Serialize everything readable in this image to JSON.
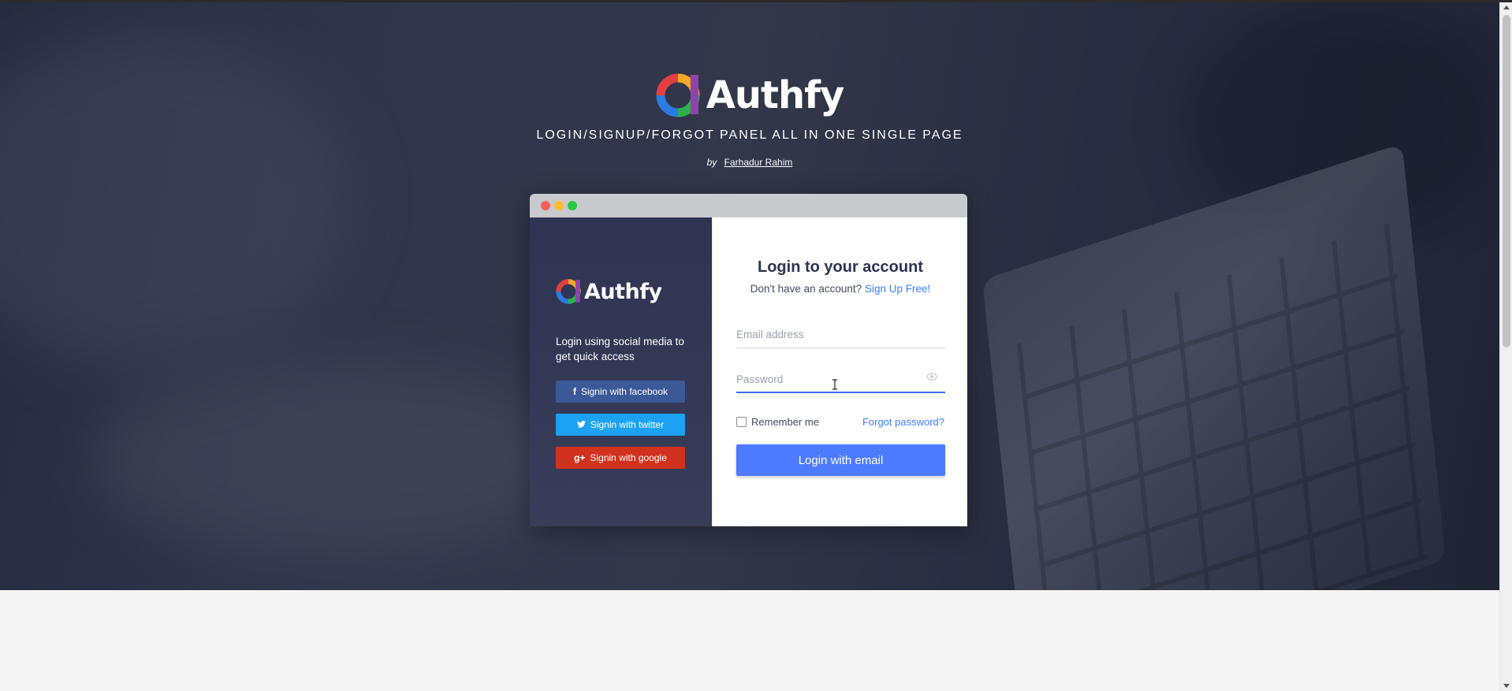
{
  "brand": {
    "name": "Authfy",
    "tagline": "LOGIN/SIGNUP/FORGOT PANEL ALL IN ONE SINGLE PAGE",
    "by_label": "by",
    "author": "Farhadur Rahim"
  },
  "panel": {
    "left": {
      "logo_text": "Authfy",
      "social_text": "Login using social media to get quick access",
      "buttons": [
        {
          "label": "Signin with facebook",
          "icon": "facebook-icon"
        },
        {
          "label": "Signin with twitter",
          "icon": "twitter-icon"
        },
        {
          "label": "Signin with google",
          "icon": "google-plus-icon"
        }
      ]
    },
    "right": {
      "title": "Login to your account",
      "no_account_text": "Don't have an account?",
      "signup_link": "Sign Up Free!",
      "email_placeholder": "Email address",
      "password_placeholder": "Password",
      "remember_label": "Remember me",
      "forgot_link": "Forgot password?",
      "login_button": "Login with email"
    }
  },
  "colors": {
    "facebook": "#3b5998",
    "twitter": "#1da1f2",
    "google": "#d0321d",
    "accent": "#4c7bff",
    "link": "#3d7eff"
  }
}
